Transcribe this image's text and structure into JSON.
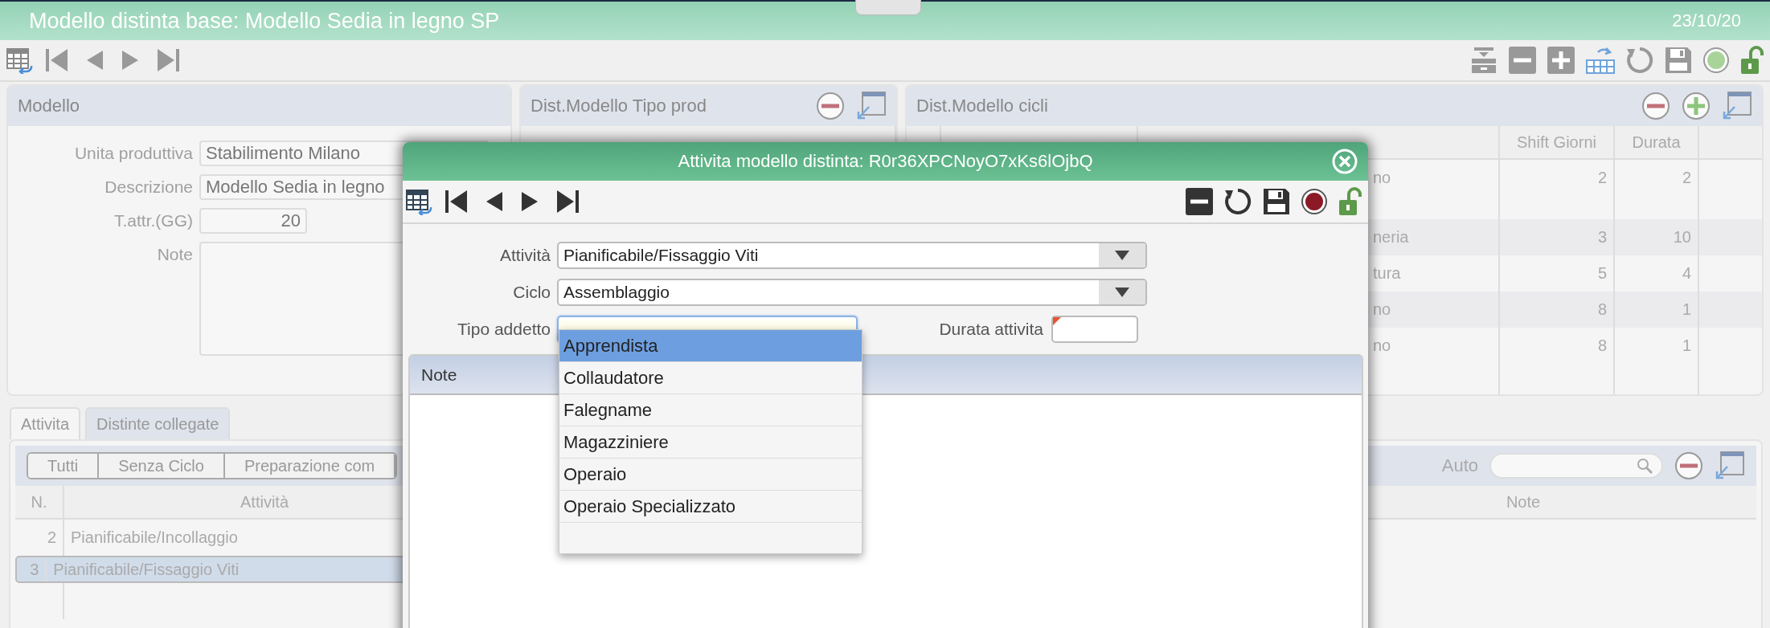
{
  "window": {
    "title": "Modello distinta base: Modello Sedia in legno SP",
    "date": "23/10/20"
  },
  "modello": {
    "title": "Modello",
    "fields": [
      {
        "label": "Unita produttiva",
        "value": "Stabilimento Milano",
        "kind": "select"
      },
      {
        "label": "Descrizione",
        "value": "Modello Sedia in legno",
        "kind": "text"
      },
      {
        "label": "T.attr.(GG)",
        "value": "20",
        "kind": "number"
      },
      {
        "label": "Note",
        "kind": "textarea"
      }
    ]
  },
  "tipo_prod": {
    "title": "Dist.Modello Tipo prod"
  },
  "cicli": {
    "title": "Dist.Modello cicli",
    "columns": [
      "Shift Giorni",
      "Durata"
    ],
    "rows": [
      {
        "centro": "no",
        "shift": "2",
        "durata": "2"
      },
      {
        "centro": "neria",
        "shift": "3",
        "durata": "10"
      },
      {
        "centro": "tura",
        "shift": "5",
        "durata": "4"
      },
      {
        "centro": "no",
        "shift": "8",
        "durata": "1"
      },
      {
        "centro": "no",
        "shift": "8",
        "durata": "1"
      }
    ]
  },
  "bottom": {
    "tabs": [
      {
        "label": "Attivita",
        "selected": true
      },
      {
        "label": "Distinte collegate",
        "selected": false
      }
    ],
    "filters": [
      "Tutti",
      "Senza Ciclo",
      "Preparazione com"
    ],
    "search_label": "Auto",
    "columns": [
      "N.",
      "Attività",
      "Note"
    ],
    "rows": [
      {
        "n": "2",
        "attivita": "Pianificabile/Incollaggio",
        "selected": false
      },
      {
        "n": "3",
        "attivita": "Pianificabile/Fissaggio Viti",
        "selected": true
      }
    ]
  },
  "dialog": {
    "title": "Attivita modello distinta: R0r36XPCNoyO7xKs6lOjbQ",
    "fields": [
      {
        "label": "Attività",
        "value": "Pianificabile/Fissaggio Viti",
        "kind": "select"
      },
      {
        "label": "Ciclo",
        "value": "Assemblaggio",
        "kind": "select"
      },
      {
        "label": "Tipo addetto",
        "kind": "text",
        "focused": true
      }
    ],
    "durata": {
      "label": "Durata attivita",
      "required": true
    },
    "note_title": "Note",
    "dropdown": [
      {
        "label": "Apprendista",
        "selected": true
      },
      {
        "label": "Collaudatore",
        "selected": false
      },
      {
        "label": "Falegname",
        "selected": false
      },
      {
        "label": "Magazziniere",
        "selected": false
      },
      {
        "label": "Operaio",
        "selected": false
      },
      {
        "label": "Operaio Specializzato",
        "selected": false
      }
    ]
  }
}
